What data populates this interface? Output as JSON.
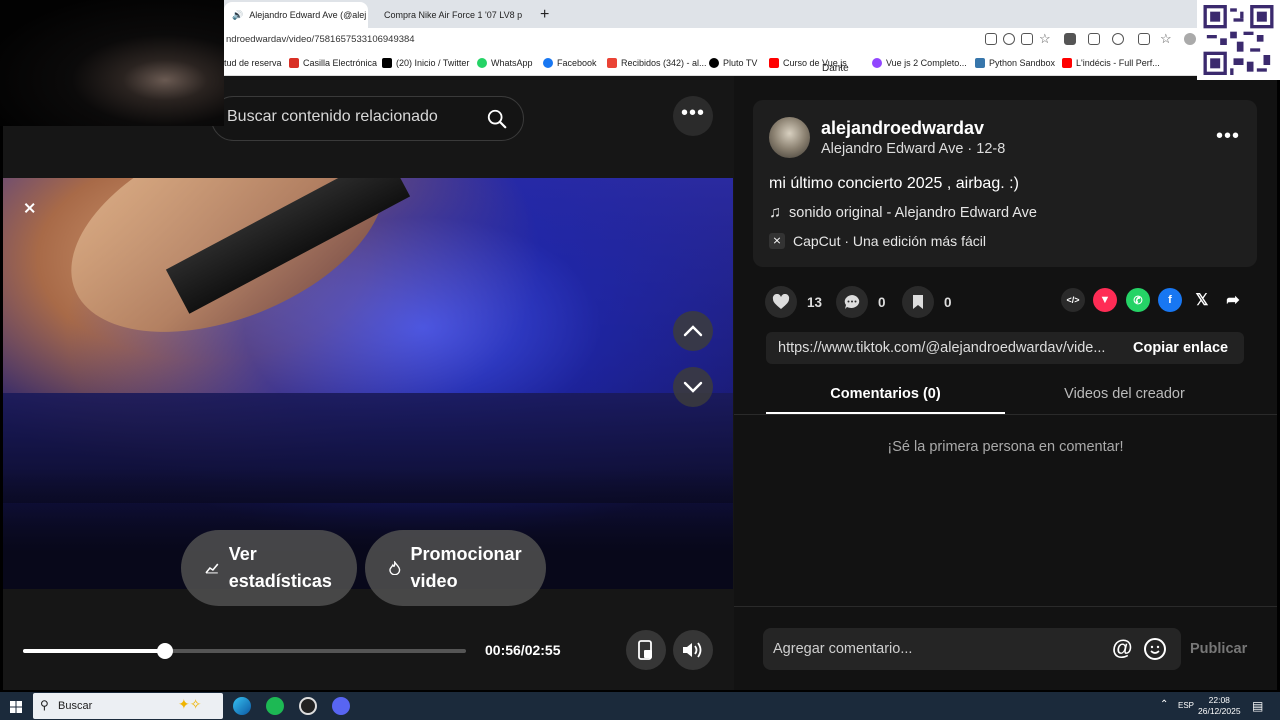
{
  "browser": {
    "tabs": [
      {
        "label": "Alejandro Edward Ave (@alej",
        "active": true
      },
      {
        "label": "Compra Nike Air Force 1 '07 LV8 p",
        "active": false
      }
    ],
    "new_tab": "+",
    "close": "×",
    "url": "ndroedwardav/video/7581657533106949384",
    "bookmarks": [
      {
        "label": "tud de reserva",
        "color": ""
      },
      {
        "label": "Casilla Electrónica",
        "color": "#d93025"
      },
      {
        "label": "(20) Inicio / Twitter",
        "color": "#000000"
      },
      {
        "label": "WhatsApp",
        "color": "#25d366"
      },
      {
        "label": "Facebook",
        "color": "#1877f2"
      },
      {
        "label": "Recibidos (342) - al...",
        "color": "#ea4335"
      },
      {
        "label": "Pluto TV",
        "color": "#000000"
      },
      {
        "label": "Curso de Vue.js",
        "color": "#ff0000"
      },
      {
        "label": "Vue js 2 Completo...",
        "color": "#9146ff"
      },
      {
        "label": "Python Sandbox",
        "color": "#3776ab"
      },
      {
        "label": "L'indécis - Full Perf...",
        "color": "#ff0000"
      }
    ],
    "broken_image_alt": "Dante"
  },
  "search": {
    "placeholder": "Buscar contenido relacionado"
  },
  "player": {
    "current_time": "00:56",
    "duration": "02:55",
    "time_display": "00:56/02:55",
    "progress_fraction": 0.32,
    "stats_button": "Ver estadísticas",
    "promote_button": "Promocionar video"
  },
  "post": {
    "username": "alejandroedwardav",
    "subtitle": "Alejandro Edward Ave · 12-8",
    "caption": "mi último concierto 2025 , airbag. :)",
    "music": "sonido original - Alejandro Edward Ave",
    "capcut": "CapCut · Una edición más fácil",
    "likes": "13",
    "comments": "0",
    "saves": "0",
    "link": "https://www.tiktok.com/@alejandroedwardav/vide...",
    "copy_link": "Copiar enlace"
  },
  "tabs": {
    "comments": "Comentarios (0)",
    "creator_videos": "Videos del creador"
  },
  "empty_comments": "¡Sé la primera persona en comentar!",
  "comment_input": {
    "placeholder": "Agregar comentario...",
    "publish": "Publicar"
  },
  "taskbar": {
    "search": "Buscar",
    "lang": "ESP",
    "time": "22:08",
    "date": "26/12/2025"
  },
  "colors": {
    "accent_pink": "#fe2c55",
    "whatsapp": "#25d366",
    "facebook": "#1877f2"
  }
}
